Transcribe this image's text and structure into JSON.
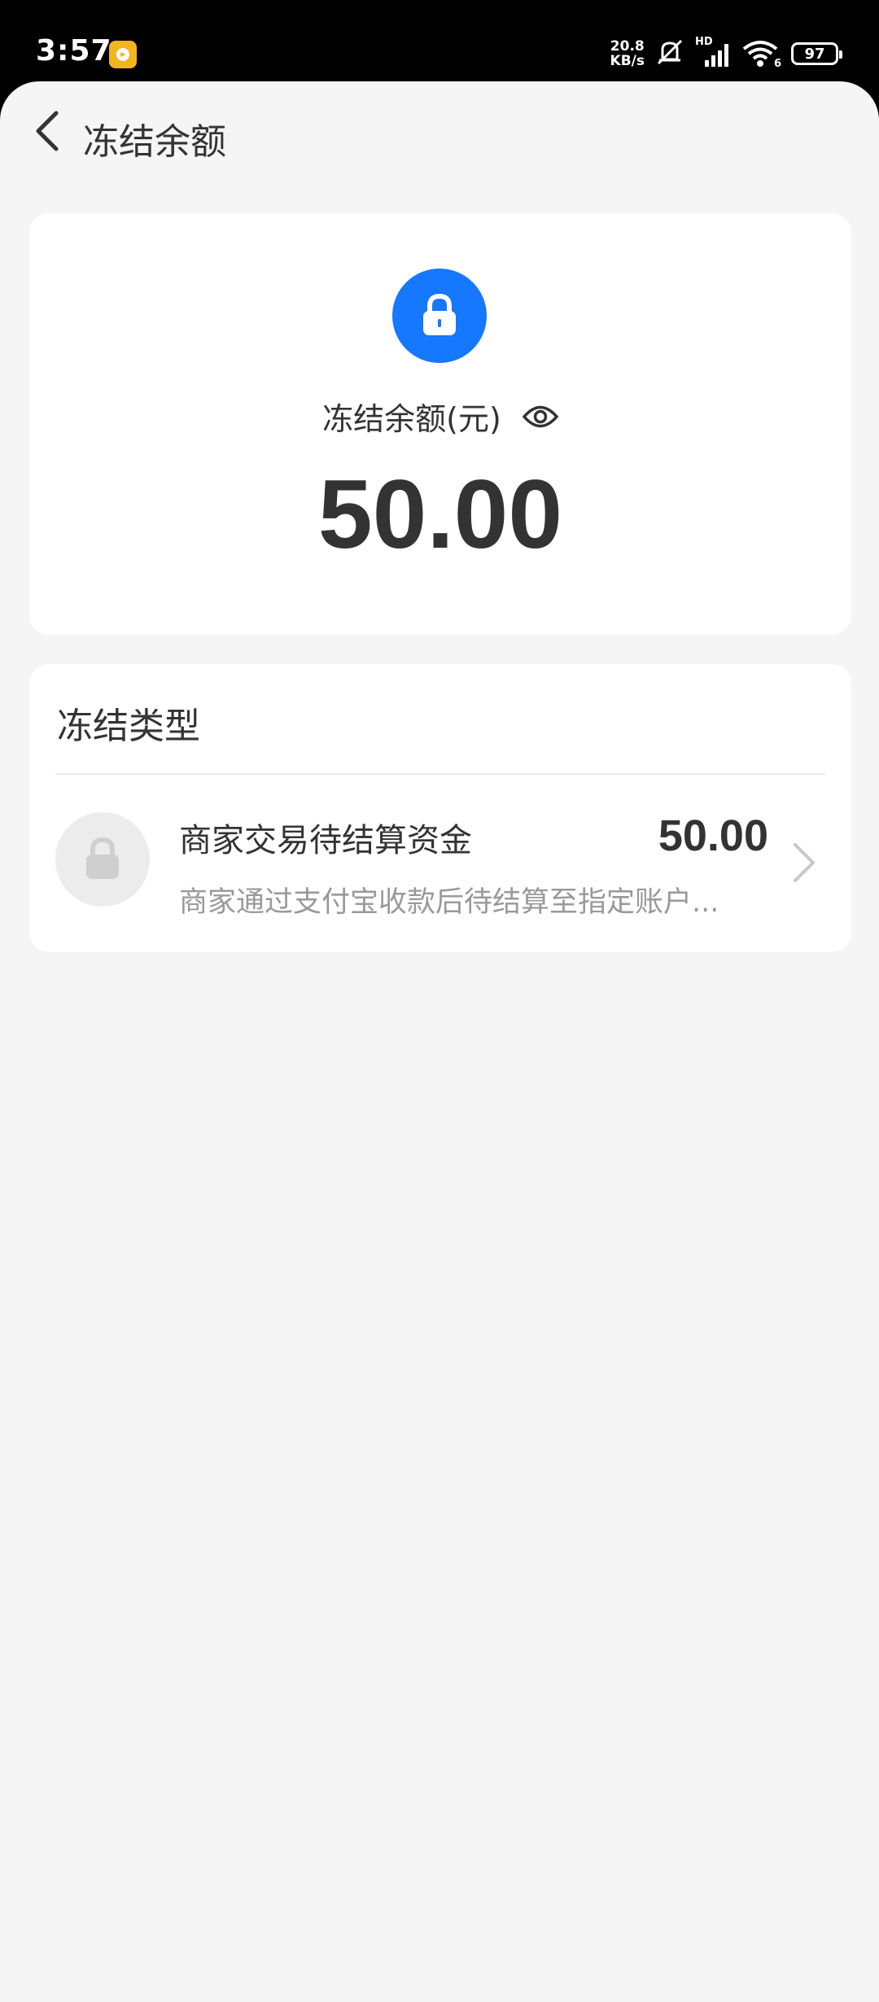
{
  "status_bar": {
    "time": "3:57",
    "net_speed_value": "20.8",
    "net_speed_unit": "KB/s",
    "signal_label": "HD",
    "wifi_label": "6",
    "battery": "97"
  },
  "header": {
    "title": "冻结余额"
  },
  "balance_card": {
    "label": "冻结余额(元)",
    "amount": "50.00",
    "accent_color": "#1677ff"
  },
  "freeze_types": {
    "title": "冻结类型",
    "items": [
      {
        "title": "商家交易待结算资金",
        "amount": "50.00",
        "description": "商家通过支付宝收款后待结算至指定账户..."
      }
    ]
  }
}
